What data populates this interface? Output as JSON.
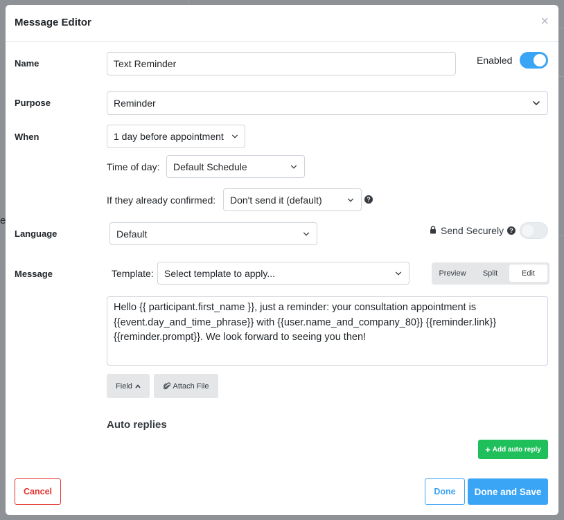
{
  "modal": {
    "title": "Message Editor",
    "close_label": "×"
  },
  "name": {
    "label": "Name",
    "value": "Text Reminder",
    "enabled_label": "Enabled",
    "enabled": true
  },
  "purpose": {
    "label": "Purpose",
    "value": "Reminder"
  },
  "when": {
    "label": "When",
    "value": "1 day before appointment",
    "time_of_day_label": "Time of day:",
    "time_of_day_value": "Default Schedule",
    "confirmed_label": "If they already confirmed:",
    "confirmed_value": "Don't send it (default)",
    "help_glyph": "?"
  },
  "language": {
    "label": "Language",
    "value": "Default",
    "send_securely_label": "Send Securely",
    "send_securely": false,
    "help_glyph": "?"
  },
  "message": {
    "label": "Message",
    "template_label": "Template:",
    "template_placeholder": "Select template to apply...",
    "modes": [
      "Preview",
      "Split",
      "Edit"
    ],
    "active_mode": "Edit",
    "body": "Hello {{ participant.first_name }}, just a reminder: your consultation appointment is {{event.day_and_time_phrase}} with {{user.name_and_company_80}} {{reminder.link}} {{reminder.prompt}}. We look forward to seeing you then!",
    "field_button": "Field",
    "attach_button": "Attach File"
  },
  "auto_replies": {
    "title": "Auto replies",
    "add_button": "Add auto reply",
    "add_glyph": "+"
  },
  "footer": {
    "cancel": "Cancel",
    "done": "Done",
    "done_and_save": "Done and Save"
  },
  "background": {
    "partial_letter": "e"
  },
  "colors": {
    "accent": "#3aa4f5",
    "danger": "#e3342f",
    "success": "#1fbf5b"
  }
}
